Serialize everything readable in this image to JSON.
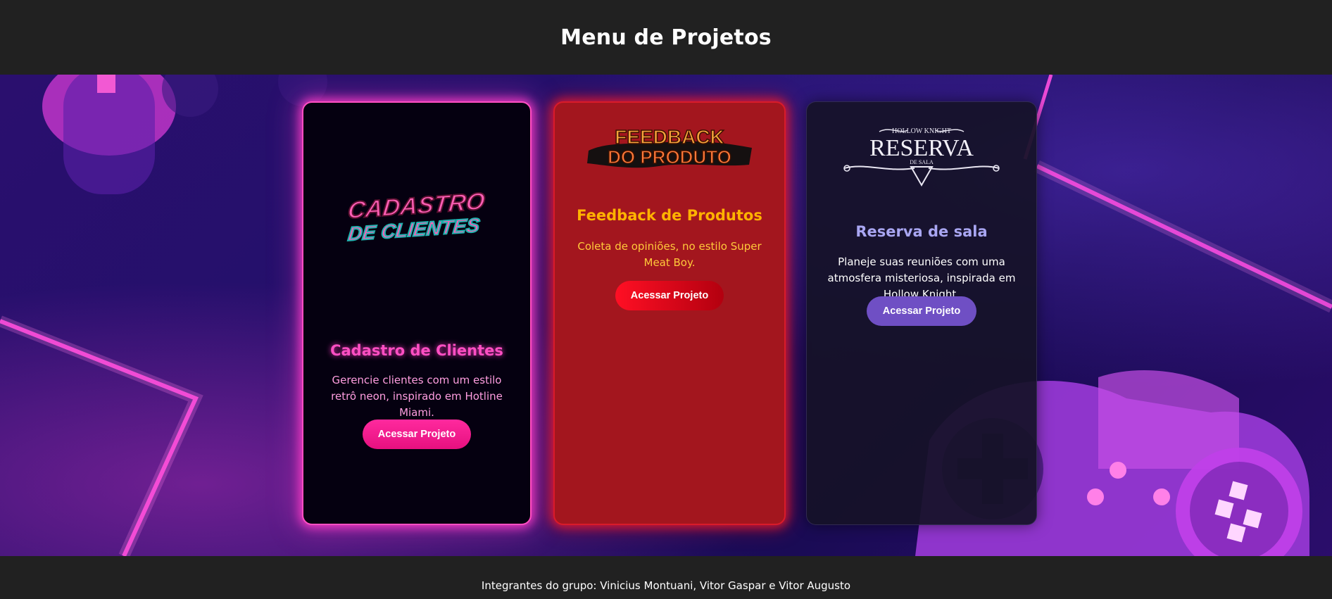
{
  "header": {
    "title": "Menu de Projetos"
  },
  "cards": [
    {
      "logo_text": [
        "CADASTRO",
        "DE CLIENTES"
      ],
      "title": "Cadastro de Clientes",
      "description": "Gerencie clientes com um estilo retrô neon, inspirado em Hotline Miami.",
      "button_label": "Acessar Projeto",
      "accent_color": "#ff4fc3",
      "logo_icon": "cadastro-de-clientes-logo"
    },
    {
      "logo_text": [
        "FEEDBACK",
        "DO PRODUTO"
      ],
      "title": "Feedback de Produtos",
      "description": "Coleta de opiniões, no estilo Super Meat Boy.",
      "button_label": "Acessar Projeto",
      "accent_color": "#ffb300",
      "logo_icon": "feedback-do-produto-logo"
    },
    {
      "logo_text": [
        "HOLLOW KNIGHT",
        "RESERVA",
        "DE SALA"
      ],
      "title": "Reserva de sala",
      "description": "Planeje suas reuniões com uma atmosfera misteriosa, inspirada em Hollow Knight.",
      "button_label": "Acessar Projeto",
      "accent_color": "#a9a6f2",
      "logo_icon": "reserva-de-sala-logo"
    }
  ],
  "footer": {
    "text": "Integrantes do grupo: Vinicius Montuani, Vitor Gaspar e Vitor Augusto"
  }
}
